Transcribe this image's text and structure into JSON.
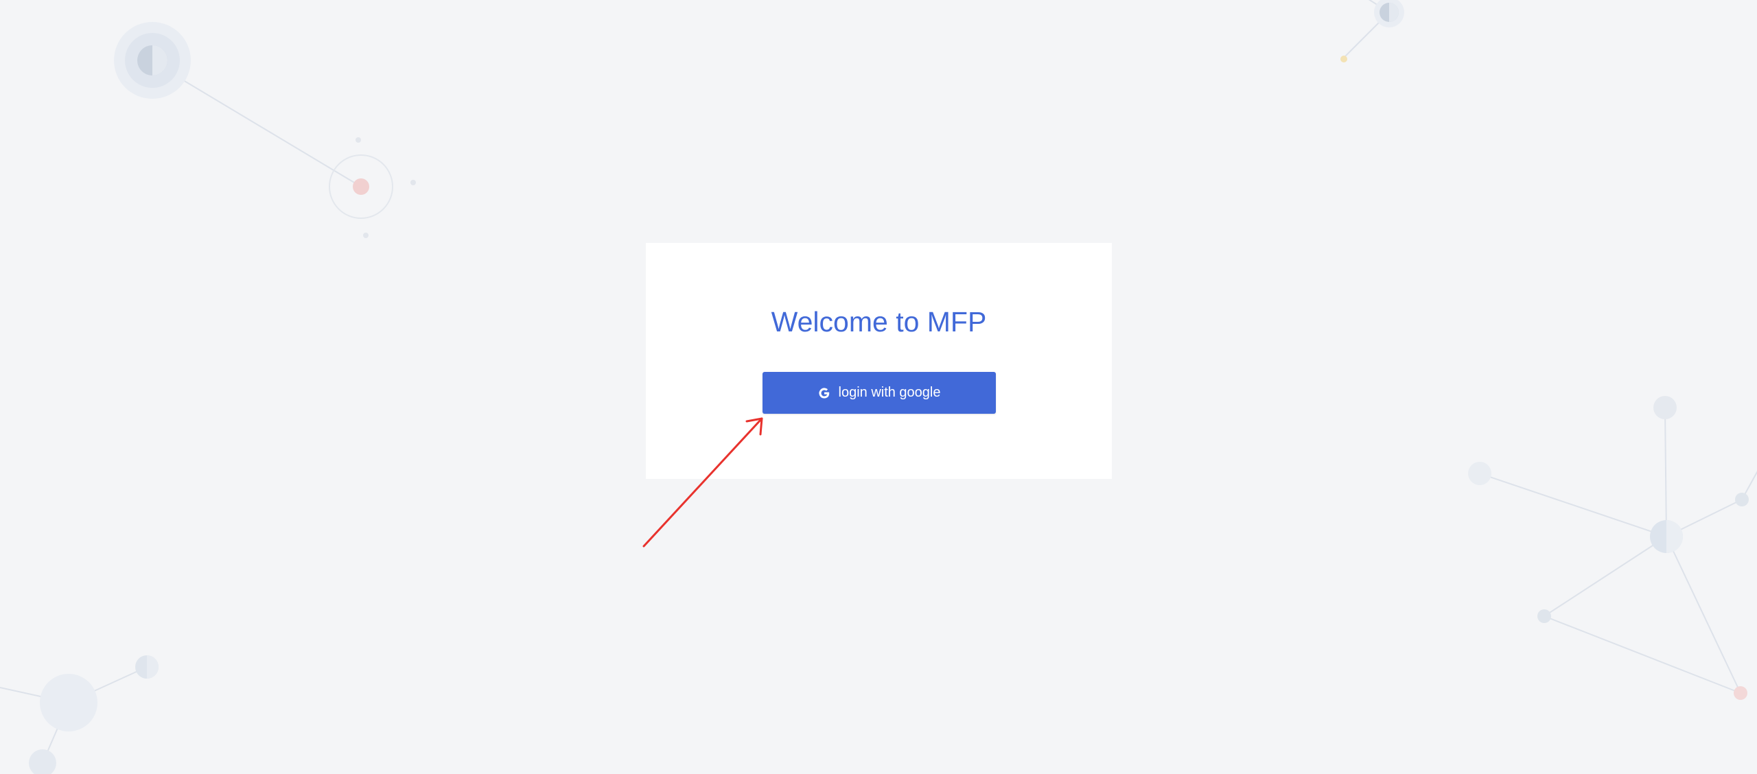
{
  "login": {
    "title": "Welcome to MFP",
    "button_label": "login with google",
    "button_icon": "google-g-icon"
  },
  "colors": {
    "background": "#f4f5f7",
    "card": "#ffffff",
    "accent": "#4169d8",
    "annotation": "#e8322d"
  },
  "annotation": {
    "type": "arrow",
    "points_to": "login-with-google-button"
  }
}
